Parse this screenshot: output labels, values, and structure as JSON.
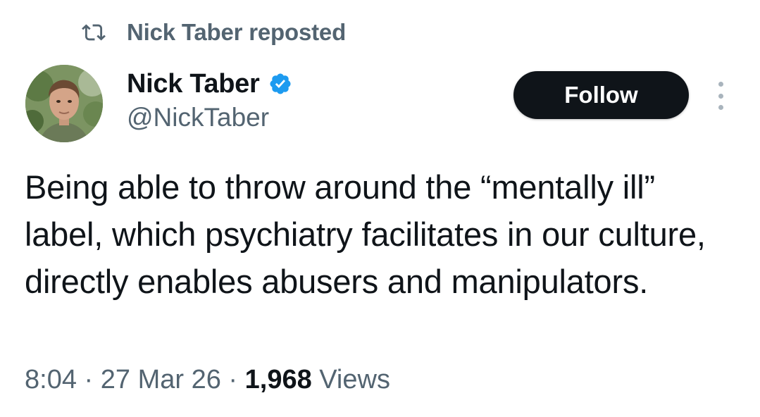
{
  "repost": {
    "icon": "repost-icon",
    "label": "Nick Taber reposted"
  },
  "author": {
    "display_name": "Nick Taber",
    "handle": "@NickTaber",
    "verified": true,
    "verified_icon": "verified-badge-icon",
    "verified_color": "#1d9bf0"
  },
  "follow_button": {
    "label": "Follow"
  },
  "more_icon": "more-options-icon",
  "tweet": {
    "text": "Being able to throw around the “mentally ill” label, which psychiatry facilitates in our culture, directly enables abusers and manipulators."
  },
  "meta": {
    "time": "8:04",
    "sep1": " · ",
    "date": "27 Mar 26",
    "sep2": " · ",
    "views_count": "1,968",
    "views_label": " Views"
  },
  "colors": {
    "text_primary": "#0f1419",
    "text_secondary": "#536471",
    "button_bg": "#0f1419",
    "button_text": "#ffffff"
  }
}
